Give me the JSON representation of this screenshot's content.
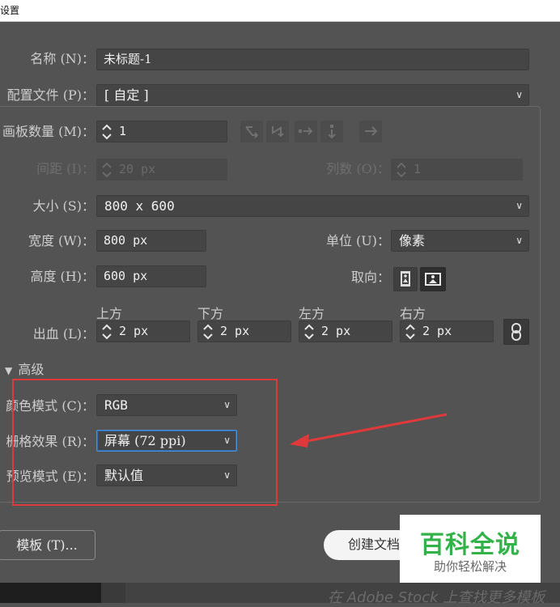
{
  "window": {
    "title": "设置"
  },
  "form": {
    "name": {
      "label": "名称 (N)：",
      "value": "未标题-1"
    },
    "profile": {
      "label": "配置文件 (P)：",
      "value": "[ 自定 ]"
    },
    "artboard_count": {
      "label": "画板数量 (M)：",
      "value": "1"
    },
    "spacing": {
      "label": "间距 (I)：",
      "value": "20 px"
    },
    "columns": {
      "label": "列数 (O)：",
      "value": "1"
    },
    "size": {
      "label": "大小 (S)：",
      "value": "800 x 600"
    },
    "width": {
      "label": "宽度 (W)：",
      "value": "800 px"
    },
    "units": {
      "label": "单位 (U)：",
      "value": "像素"
    },
    "height": {
      "label": "高度 (H)：",
      "value": "600 px"
    },
    "orientation": {
      "label": "取向：",
      "options": [
        "portrait",
        "landscape"
      ],
      "selected": "landscape"
    },
    "bleed": {
      "label": "出血 (L)：",
      "top": {
        "label": "上方",
        "value": "2 px"
      },
      "bottom": {
        "label": "下方",
        "value": "2 px"
      },
      "left": {
        "label": "左方",
        "value": "2 px"
      },
      "right": {
        "label": "右方",
        "value": "2 px"
      },
      "link_icon": "link-chain-icon"
    },
    "advanced": {
      "label": "高级",
      "expanded": true
    },
    "color_mode": {
      "label": "颜色模式 (C)：",
      "value": "RGB"
    },
    "raster_effects": {
      "label": "栅格效果 (R)：",
      "value": "屏幕 (72 ppi)"
    },
    "preview_mode": {
      "label": "预览模式 (E)：",
      "value": "默认值"
    }
  },
  "buttons": {
    "templates": "模板 (T)...",
    "create_doc": "创建文档"
  },
  "watermark": {
    "title": "百科全说",
    "subtitle": "助你轻松解决"
  },
  "bottom_bar": {
    "text": "在 Adobe Stock 上查找更多模板"
  },
  "colors": {
    "annotation": "#e0393b",
    "focus": "#4a8fdc",
    "brand_green": "#33b24a"
  }
}
